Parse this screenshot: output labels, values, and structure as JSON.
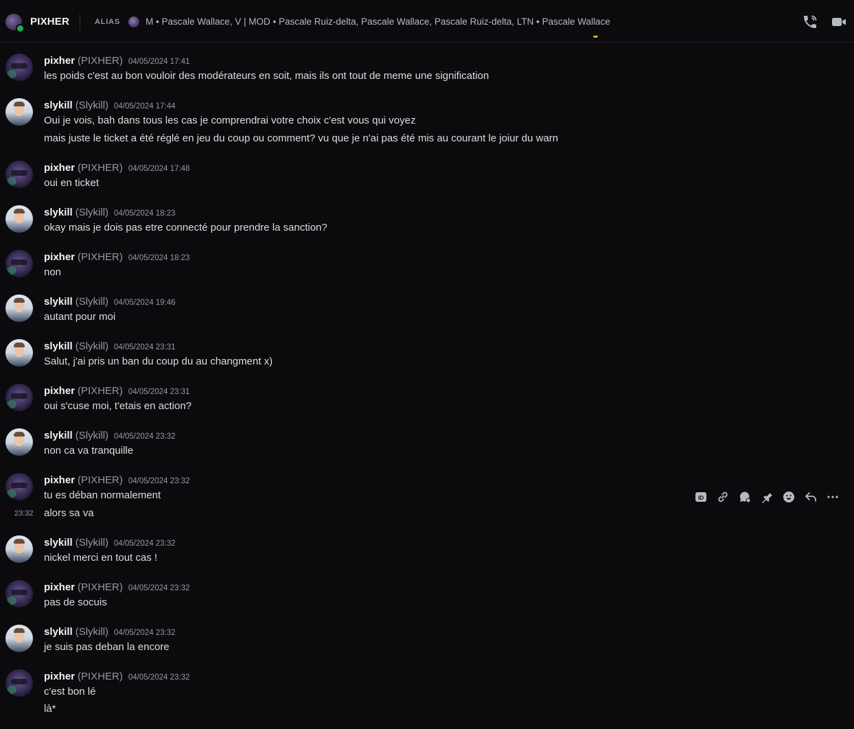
{
  "header": {
    "title": "PIXHER",
    "alias_label": "ALIAS",
    "alias_text": "M • Pascale Wallace, V | MOD • Pascale Ruiz-delta, Pascale Wallace, Pascale Ruiz-delta, LTN • Pascale Wallace",
    "icons": [
      "phone-call-icon",
      "video-camera-icon"
    ],
    "status_color": "#23a55a"
  },
  "messages": [
    {
      "author": "pixher",
      "alias": "(PIXHER)",
      "timestamp": "04/05/2024 17:41",
      "lines": [
        "les poids c'est au bon vouloir des modérateurs en soit, mais ils ont tout de meme une signification"
      ]
    },
    {
      "author": "slykill",
      "alias": "(Slykill)",
      "timestamp": "04/05/2024 17:44",
      "lines": [
        "Oui je vois, bah dans tous les cas je comprendrai votre choix c'est vous qui voyez",
        "mais juste le ticket a été réglé en jeu du coup ou comment? vu que je n'ai pas été mis au courant le joiur du warn"
      ]
    },
    {
      "author": "pixher",
      "alias": "(PIXHER)",
      "timestamp": "04/05/2024 17:48",
      "lines": [
        "oui en ticket"
      ]
    },
    {
      "author": "slykill",
      "alias": "(Slykill)",
      "timestamp": "04/05/2024 18:23",
      "lines": [
        "okay mais je dois pas etre connecté pour prendre la sanction?"
      ]
    },
    {
      "author": "pixher",
      "alias": "(PIXHER)",
      "timestamp": "04/05/2024 18:23",
      "lines": [
        "non"
      ]
    },
    {
      "author": "slykill",
      "alias": "(Slykill)",
      "timestamp": "04/05/2024 19:46",
      "lines": [
        "autant pour moi"
      ]
    },
    {
      "author": "slykill",
      "alias": "(Slykill)",
      "timestamp": "04/05/2024 23:31",
      "lines": [
        "Salut, j'ai pris un ban du coup du au changment x)"
      ]
    },
    {
      "author": "pixher",
      "alias": "(PIXHER)",
      "timestamp": "04/05/2024 23:31",
      "lines": [
        "oui s'cuse moi, t'etais en action?"
      ]
    },
    {
      "author": "slykill",
      "alias": "(Slykill)",
      "timestamp": "04/05/2024 23:32",
      "lines": [
        "non ca va tranquille"
      ]
    },
    {
      "author": "pixher",
      "alias": "(PIXHER)",
      "timestamp": "04/05/2024 23:32",
      "lines": [
        "tu es déban normalement",
        "alors sa va"
      ],
      "hover_timestamp": "23:32"
    },
    {
      "author": "slykill",
      "alias": "(Slykill)",
      "timestamp": "04/05/2024 23:32",
      "lines": [
        "nickel merci en tout cas !"
      ]
    },
    {
      "author": "pixher",
      "alias": "(PIXHER)",
      "timestamp": "04/05/2024 23:32",
      "lines": [
        "pas de socuis"
      ]
    },
    {
      "author": "slykill",
      "alias": "(Slykill)",
      "timestamp": "04/05/2024 23:32",
      "lines": [
        "je suis pas deban la encore"
      ]
    },
    {
      "author": "pixher",
      "alias": "(PIXHER)",
      "timestamp": "04/05/2024 23:32",
      "lines": [
        "c'est bon lé",
        "là*"
      ]
    }
  ],
  "message_toolbar": {
    "icons": [
      "copy-id-icon",
      "copy-link-icon",
      "create-thread-icon",
      "pin-icon",
      "add-reaction-icon",
      "reply-icon",
      "more-options-icon"
    ]
  },
  "colors": {
    "background": "#0b0b0d",
    "text": "#dbdee1",
    "muted": "#949ba4",
    "author": "#f2f3f5"
  }
}
